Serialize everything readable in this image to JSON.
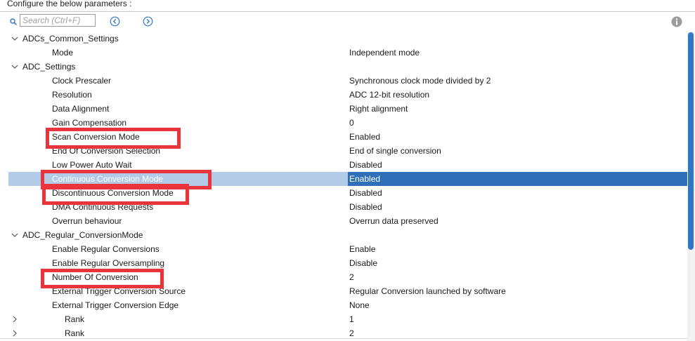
{
  "header": {
    "title": "Configure the below parameters :"
  },
  "toolbar": {
    "search_placeholder": "Search (Ctrl+F)"
  },
  "tree": {
    "group_adc_common": "ADCs_Common_Settings",
    "mode_label": "Mode",
    "mode_value": "Independent mode",
    "group_adc_settings": "ADC_Settings",
    "clock_prescaler_label": "Clock Prescaler",
    "clock_prescaler_value": "Synchronous clock mode divided by 2",
    "resolution_label": "Resolution",
    "resolution_value": "ADC 12-bit resolution",
    "data_alignment_label": "Data Alignment",
    "data_alignment_value": "Right alignment",
    "gain_compensation_label": "Gain Compensation",
    "gain_compensation_value": "0",
    "scan_conversion_label": "Scan Conversion Mode",
    "scan_conversion_value": "Enabled",
    "eoc_selection_label": "End Of Conversion Selection",
    "eoc_selection_value": "End of single conversion",
    "low_power_label": "Low Power Auto Wait",
    "low_power_value": "Disabled",
    "continuous_label": "Continuous Conversion Mode",
    "continuous_value": "Enabled",
    "discontinuous_label": "Discontinuous Conversion Mode",
    "discontinuous_value": "Disabled",
    "dma_label": "DMA Continuous Requests",
    "dma_value": "Disabled",
    "overrun_label": "Overrun behaviour",
    "overrun_value": "Overrun data preserved",
    "group_regular": "ADC_Regular_ConversionMode",
    "enable_regular_label": "Enable Regular Conversions",
    "enable_regular_value": "Enable",
    "oversampling_label": "Enable Regular Oversampling",
    "oversampling_value": "Disable",
    "num_conversion_label": "Number Of Conversion",
    "num_conversion_value": "2",
    "ext_trigger_source_label": "External Trigger Conversion Source",
    "ext_trigger_source_value": "Regular Conversion launched by software",
    "ext_trigger_edge_label": "External Trigger Conversion Edge",
    "ext_trigger_edge_value": "None",
    "rank1_label": "Rank",
    "rank1_value": "1",
    "rank2_label": "Rank",
    "rank2_value": "2"
  },
  "colors": {
    "highlight_box": "#e8343a",
    "selected_row": "#b3cbe6",
    "selected_value_cell": "#2f6fba",
    "scrollbar_thumb": "#2f78c8",
    "nav_button": "#2f78c8"
  }
}
